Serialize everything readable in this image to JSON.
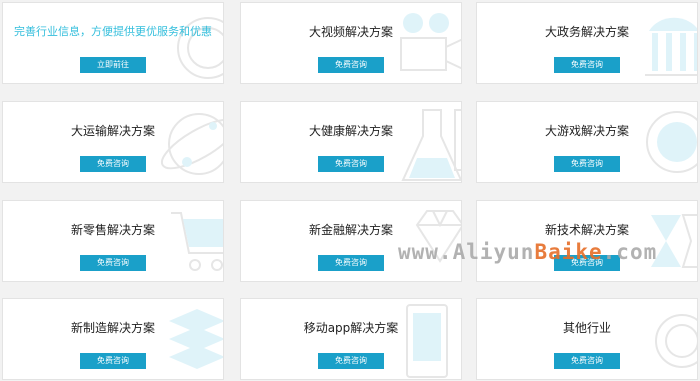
{
  "cards": [
    {
      "title": "完善行业信息，方便提供更优服务和优惠",
      "button": "立即前往"
    },
    {
      "title": "大视频解决方案",
      "button": "免费咨询"
    },
    {
      "title": "大政务解决方案",
      "button": "免费咨询"
    },
    {
      "title": "大运输解决方案",
      "button": "免费咨询"
    },
    {
      "title": "大健康解决方案",
      "button": "免费咨询"
    },
    {
      "title": "大游戏解决方案",
      "button": "免费咨询"
    },
    {
      "title": "新零售解决方案",
      "button": "免费咨询"
    },
    {
      "title": "新金融解决方案",
      "button": "免费咨询"
    },
    {
      "title": "新技术解决方案",
      "button": "免费咨询"
    },
    {
      "title": "新制造解决方案",
      "button": "免费咨询"
    },
    {
      "title": "移动app解决方案",
      "button": "免费咨询"
    },
    {
      "title": "其他行业",
      "button": "免费咨询"
    }
  ],
  "watermark": {
    "part1": "www.Aliyun",
    "part2": "Baike",
    "part3": ".com"
  },
  "colors": {
    "accent": "#1aa0c9",
    "promo_text": "#33bedc",
    "icon_line": "#e6e6e6",
    "icon_fill": "#dff3f9"
  }
}
